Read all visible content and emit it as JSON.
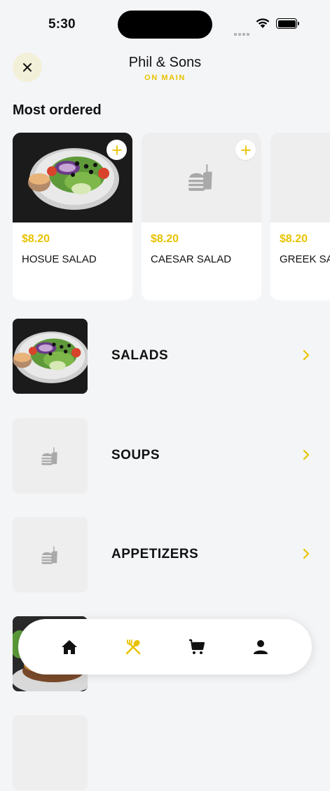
{
  "status_bar": {
    "time": "5:30"
  },
  "header": {
    "title": "Phil & Sons",
    "subtitle": "ON MAIN"
  },
  "most_ordered": {
    "title": "Most ordered",
    "items": [
      {
        "price": "$8.20",
        "name": "HOSUE SALAD",
        "image": "salad-photo"
      },
      {
        "price": "$8.20",
        "name": "CAESAR SALAD",
        "image": "food-placeholder-icon"
      },
      {
        "price": "$8.20",
        "name": "GREEK SALAD",
        "image": "food-placeholder-icon"
      }
    ]
  },
  "categories": [
    {
      "label": "SALADS",
      "image": "salad-photo"
    },
    {
      "label": "SOUPS",
      "image": "food-placeholder-icon"
    },
    {
      "label": "APPETIZERS",
      "image": "food-placeholder-icon"
    },
    {
      "label": "",
      "image": "burger-photo"
    }
  ],
  "tab_bar": {
    "tabs": [
      {
        "icon": "home-icon",
        "active": false
      },
      {
        "icon": "utensils-icon",
        "active": true
      },
      {
        "icon": "cart-icon",
        "active": false
      },
      {
        "icon": "profile-icon",
        "active": false
      }
    ]
  },
  "colors": {
    "accent": "#e8c300",
    "background": "#f4f5f7",
    "card": "#ffffff",
    "close_button_bg": "#f3f0d9"
  }
}
